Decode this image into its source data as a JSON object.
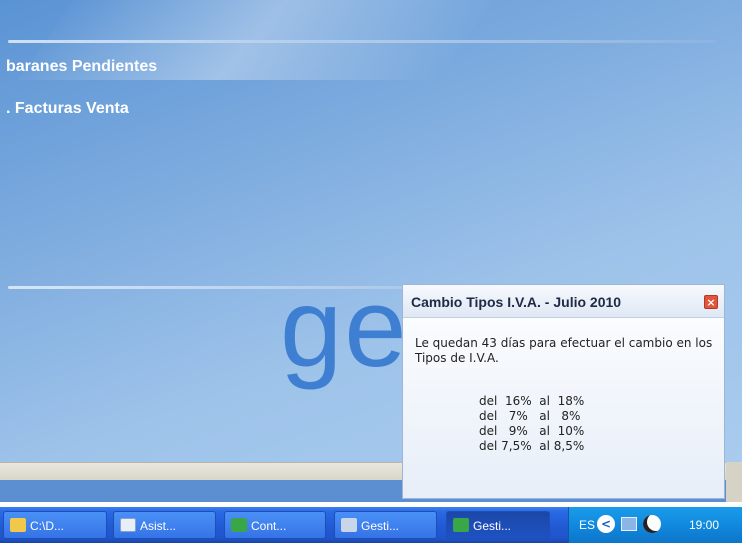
{
  "app": {
    "menu_items": [
      "baranes Pendientes",
      ". Facturas Venta"
    ],
    "logo_text": "ge"
  },
  "popup": {
    "title": "Cambio Tipos I.V.A. - Julio 2010",
    "close_glyph": "×",
    "message": "Le quedan 43 días para efectuar el cambio en los Tipos de I.V.A.",
    "rates": [
      "del  16%  al  18%",
      "del   7%   al   8%",
      "del   9%   al  10%",
      "del 7,5%  al 8,5%"
    ]
  },
  "taskbar": {
    "buttons": [
      {
        "label": "C:\\D...",
        "icon": "folder-icon"
      },
      {
        "label": "Asist...",
        "icon": "word-document-icon"
      },
      {
        "label": "Cont...",
        "icon": "app-icon"
      },
      {
        "label": "Gesti...",
        "icon": "install-icon"
      },
      {
        "label": "Gesti...",
        "icon": "app-icon",
        "active": true
      }
    ],
    "language": "ES",
    "tray_expand_glyph": "<",
    "clock": "19:00"
  }
}
